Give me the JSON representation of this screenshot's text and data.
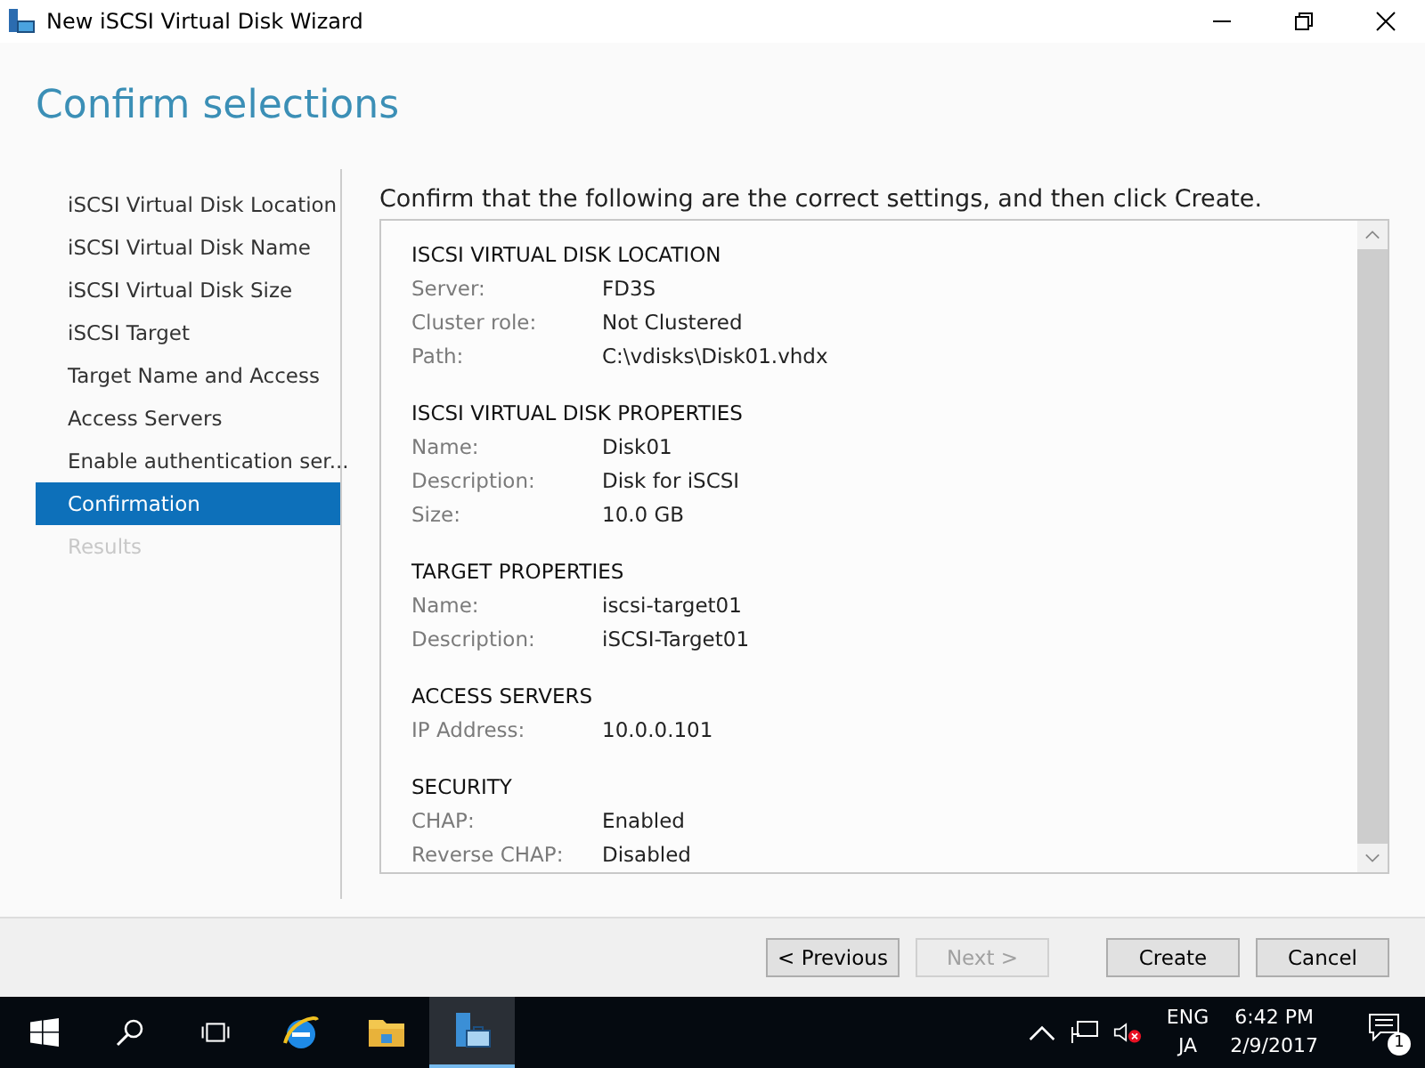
{
  "window": {
    "title": "New iSCSI Virtual Disk Wizard"
  },
  "heading": "Confirm selections",
  "steps": [
    {
      "label": "iSCSI Virtual Disk Location",
      "selected": false,
      "disabled": false
    },
    {
      "label": "iSCSI Virtual Disk Name",
      "selected": false,
      "disabled": false
    },
    {
      "label": "iSCSI Virtual Disk Size",
      "selected": false,
      "disabled": false
    },
    {
      "label": "iSCSI Target",
      "selected": false,
      "disabled": false
    },
    {
      "label": "Target Name and Access",
      "selected": false,
      "disabled": false
    },
    {
      "label": "Access Servers",
      "selected": false,
      "disabled": false
    },
    {
      "label": "Enable authentication ser...",
      "selected": false,
      "disabled": false
    },
    {
      "label": "Confirmation",
      "selected": true,
      "disabled": false
    },
    {
      "label": "Results",
      "selected": false,
      "disabled": true
    }
  ],
  "instruction": "Confirm that the following are the correct settings, and then click Create.",
  "sections": [
    {
      "title": "ISCSI VIRTUAL DISK LOCATION",
      "rows": [
        {
          "label": "Server:",
          "value": "FD3S"
        },
        {
          "label": "Cluster role:",
          "value": "Not Clustered"
        },
        {
          "label": "Path:",
          "value": "C:\\vdisks\\Disk01.vhdx"
        }
      ]
    },
    {
      "title": "ISCSI VIRTUAL DISK PROPERTIES",
      "rows": [
        {
          "label": "Name:",
          "value": "Disk01"
        },
        {
          "label": "Description:",
          "value": "Disk for iSCSI"
        },
        {
          "label": "Size:",
          "value": "10.0 GB"
        }
      ]
    },
    {
      "title": "TARGET PROPERTIES",
      "rows": [
        {
          "label": "Name:",
          "value": "iscsi-target01"
        },
        {
          "label": "Description:",
          "value": "iSCSI-Target01"
        }
      ]
    },
    {
      "title": "ACCESS SERVERS",
      "rows": [
        {
          "label": "IP Address:",
          "value": "10.0.0.101"
        }
      ]
    },
    {
      "title": "SECURITY",
      "rows": [
        {
          "label": "CHAP:",
          "value": "Enabled"
        },
        {
          "label": "Reverse CHAP:",
          "value": "Disabled"
        }
      ]
    }
  ],
  "buttons": [
    {
      "label": "< Previous",
      "disabled": false
    },
    {
      "label": "Next >",
      "disabled": true
    },
    {
      "label": "Create",
      "disabled": false
    },
    {
      "label": "Cancel",
      "disabled": false
    }
  ],
  "taskbar": {
    "apps": [
      {
        "kind": "browser",
        "active": false
      },
      {
        "kind": "folder",
        "active": false
      },
      {
        "kind": "wizard",
        "active": true
      }
    ],
    "language": "ENG",
    "input": "JA",
    "time": "6:42 PM",
    "date": "2/9/2017",
    "notifications": "1"
  }
}
